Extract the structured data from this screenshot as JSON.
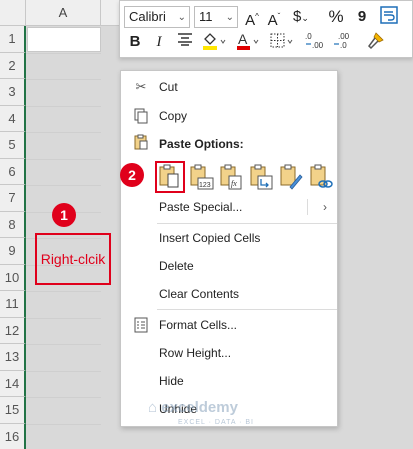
{
  "sheet": {
    "column_header": "A",
    "rows": [
      "1",
      "2",
      "3",
      "4",
      "5",
      "6",
      "7",
      "8",
      "9",
      "10",
      "11",
      "12",
      "13",
      "14",
      "15",
      "16"
    ]
  },
  "annotations": {
    "badge1": "1",
    "badge2": "2",
    "right_click_label": "Right-clcik"
  },
  "mini_toolbar": {
    "font_name": "Calibri",
    "font_size": "11",
    "bold": "B",
    "italic": "I",
    "currency": "$",
    "percent": "%",
    "comma": "9"
  },
  "context_menu": {
    "cut": "Cut",
    "copy": "Copy",
    "paste_options": "Paste Options:",
    "paste_special": "Paste Special...",
    "insert_copied_cells": "Insert Copied Cells",
    "delete": "Delete",
    "clear_contents": "Clear Contents",
    "format_cells": "Format Cells...",
    "row_height": "Row Height...",
    "hide": "Hide",
    "unhide": "Unhide"
  },
  "watermark": {
    "brand": "exceldemy",
    "tagline": "EXCEL · DATA · BI"
  },
  "colors": {
    "annotation_red": "#e0001b",
    "selection_green": "#217346"
  }
}
